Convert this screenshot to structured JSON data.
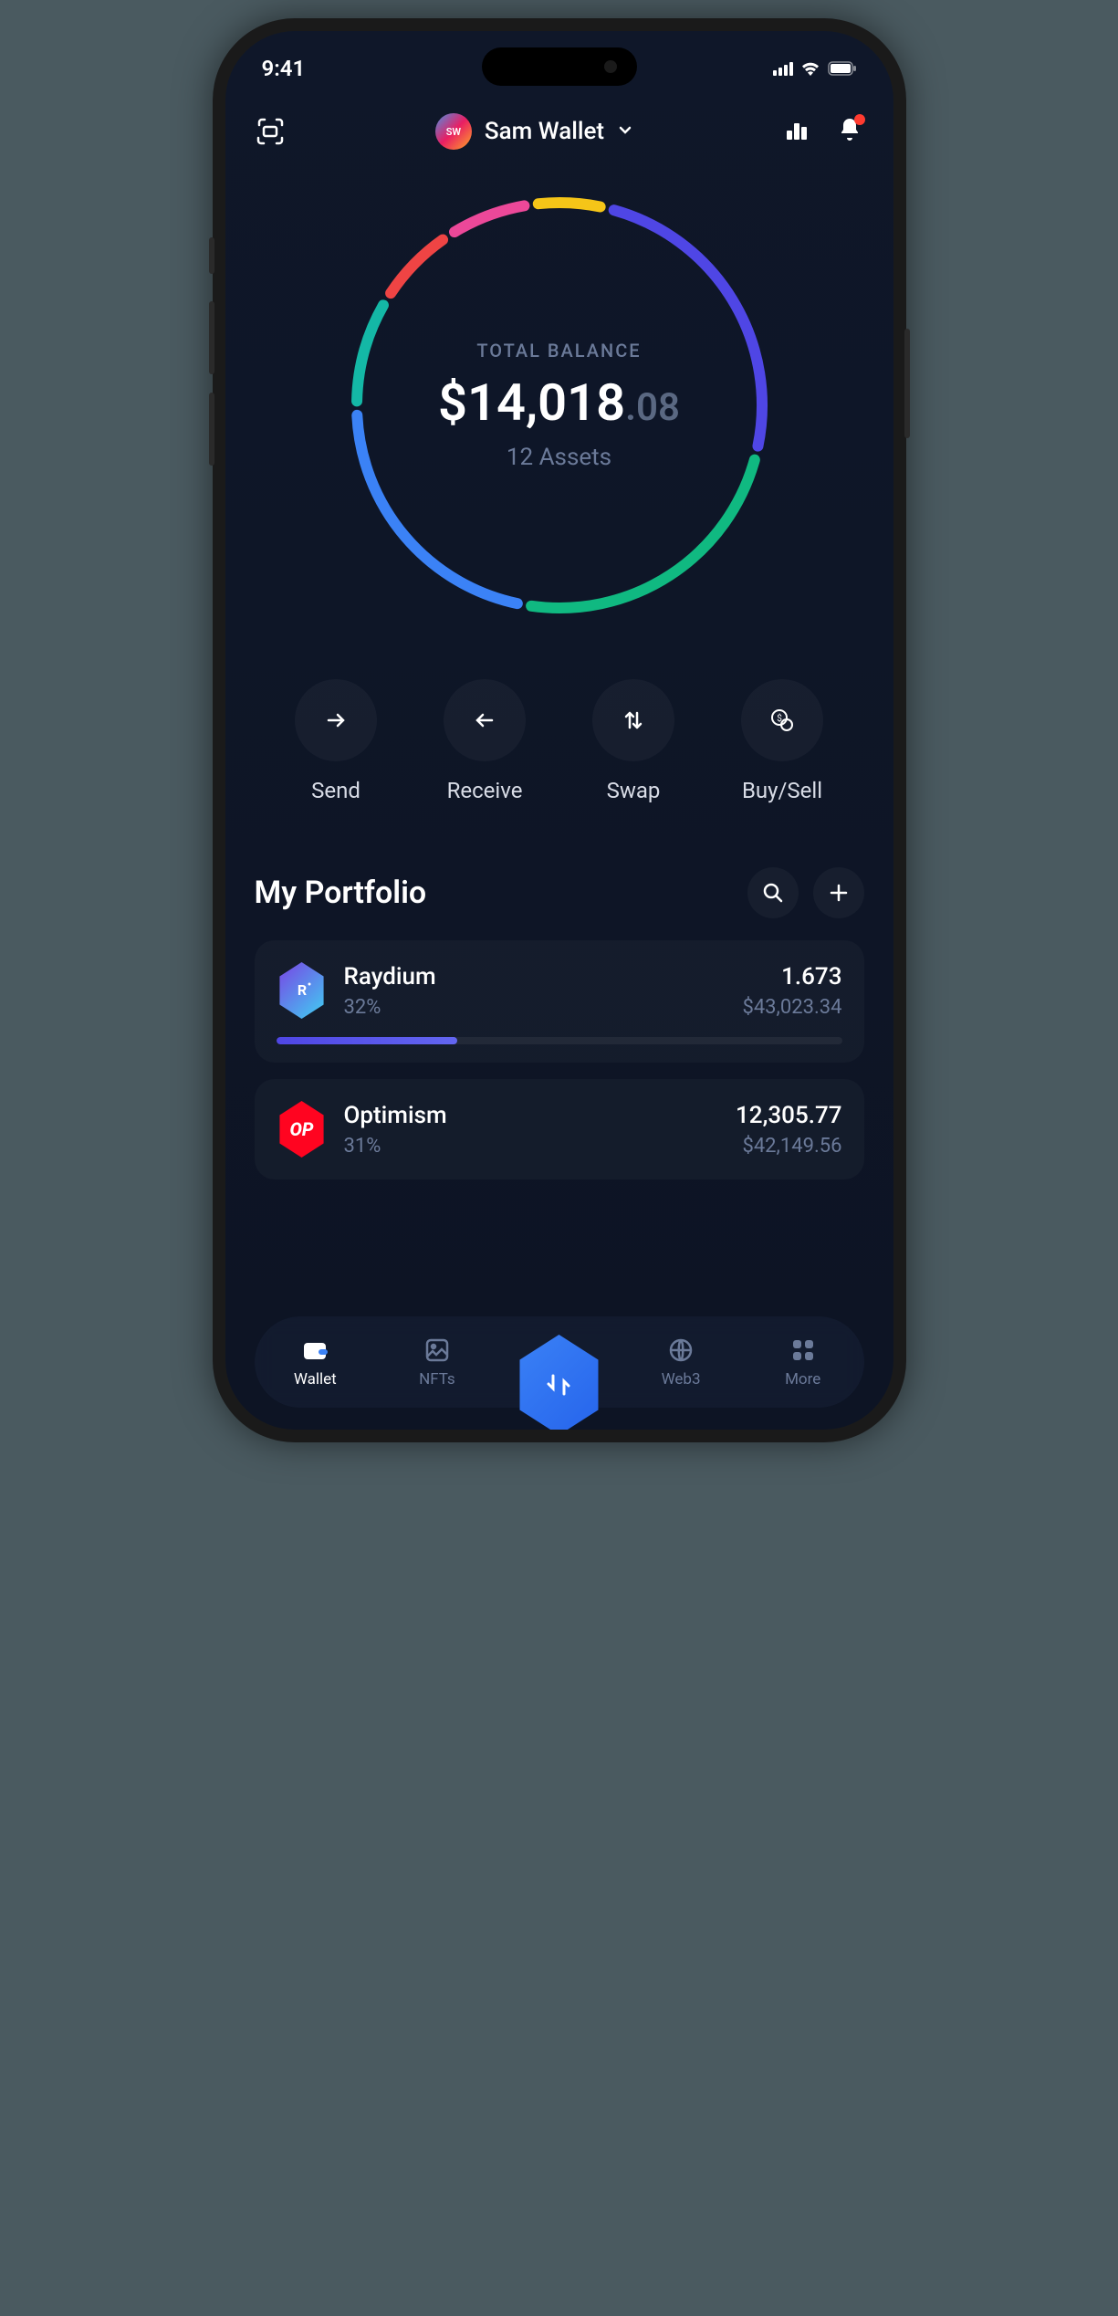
{
  "status": {
    "time": "9:41"
  },
  "header": {
    "wallet_initials": "SW",
    "wallet_name": "Sam Wallet"
  },
  "balance": {
    "label": "TOTAL BALANCE",
    "currency": "$",
    "whole": "14,018",
    "cents": ".08",
    "assets": "12 Assets"
  },
  "chart_data": {
    "type": "pie",
    "title": "Portfolio allocation",
    "series": [
      {
        "name": "Yellow",
        "value": 6,
        "color": "#f5c518"
      },
      {
        "name": "Indigo",
        "value": 25,
        "color": "#4f46e5"
      },
      {
        "name": "Green",
        "value": 24,
        "color": "#10b981"
      },
      {
        "name": "Blue",
        "value": 22,
        "color": "#3b82f6"
      },
      {
        "name": "Teal",
        "value": 9,
        "color": "#14b8a6"
      },
      {
        "name": "Red",
        "value": 7,
        "color": "#ef4444"
      },
      {
        "name": "Magenta",
        "value": 7,
        "color": "#ec4899"
      }
    ]
  },
  "actions": {
    "send": "Send",
    "receive": "Receive",
    "swap": "Swap",
    "buysell": "Buy/Sell"
  },
  "portfolio": {
    "title": "My Portfolio",
    "items": [
      {
        "name": "Raydium",
        "percent": "32%",
        "amount": "1.673",
        "fiat": "$43,023.34",
        "progress": 32,
        "color": "#4f46e5"
      },
      {
        "name": "Optimism",
        "percent": "31%",
        "amount": "12,305.77",
        "fiat": "$42,149.56",
        "progress": 31,
        "color": "#ff0420"
      }
    ]
  },
  "nav": {
    "wallet": "Wallet",
    "nfts": "NFTs",
    "web3": "Web3",
    "more": "More"
  }
}
